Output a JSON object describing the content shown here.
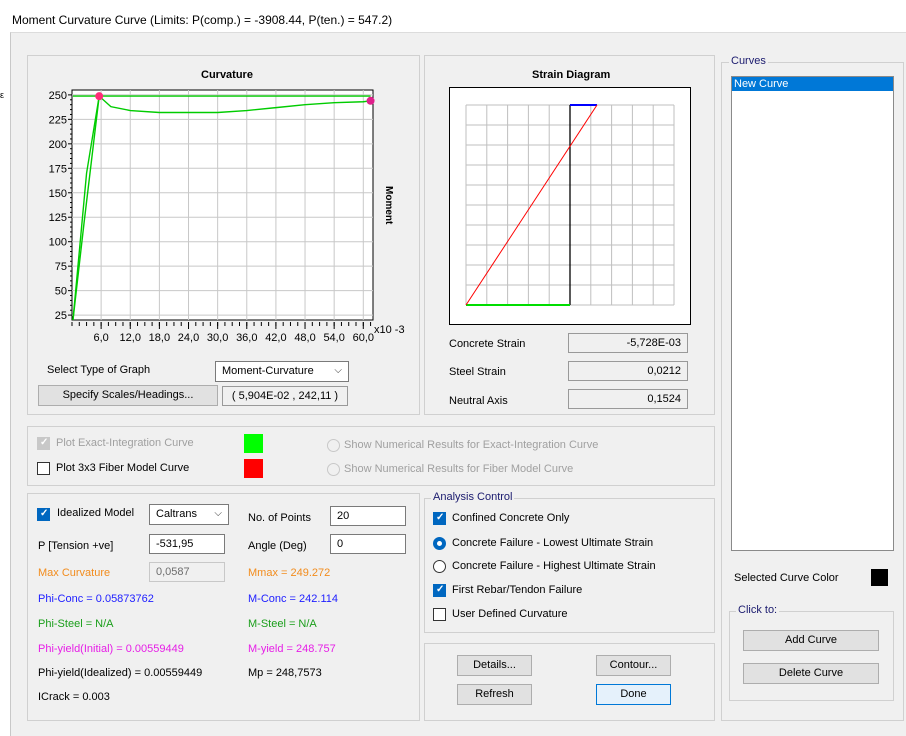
{
  "window": {
    "title": "Moment Curvature Curve (Limits:  P(comp.) = -3908.44, P(ten.) = 547.2)"
  },
  "curvature_plot": {
    "title": "Curvature",
    "ylabel": "Moment",
    "yticks": [
      "250",
      "225",
      "200",
      "175",
      "150",
      "125",
      "100",
      "75",
      "50",
      "25"
    ],
    "xticks": [
      "6,0",
      "12,0",
      "18,0",
      "24,0",
      "30,0",
      "36,0",
      "42,0",
      "48,0",
      "54,0",
      "60,0"
    ],
    "xexp": "x10 -3"
  },
  "chart_data": [
    {
      "type": "line",
      "title": "Curvature",
      "ylabel": "Moment",
      "xunit": "x10 -3",
      "xlim": [
        0,
        62
      ],
      "ylim": [
        20,
        255
      ],
      "series": [
        {
          "color": "#00cc00",
          "x": [
            0.2,
            2.5,
            5.6,
            8,
            12,
            18,
            24,
            30,
            36,
            42,
            48,
            54,
            60,
            61.5
          ],
          "y": [
            20,
            120,
            248.7,
            238,
            234,
            232,
            232,
            232,
            234,
            237,
            240,
            242,
            243,
            244
          ]
        },
        {
          "color": "#00cc00",
          "x": [
            0.2,
            3,
            5.6
          ],
          "y": [
            20,
            170,
            248.7
          ]
        },
        {
          "color": "#00cc00",
          "x": [
            0.2,
            5.6,
            61.5
          ],
          "y": [
            248.757,
            248.757,
            248.757
          ]
        }
      ],
      "markers": [
        {
          "x": 5.6,
          "y": 248.7,
          "color": "#ff2d78"
        },
        {
          "x": 61.5,
          "y": 244,
          "color": "#e0208c"
        }
      ]
    },
    {
      "type": "line",
      "title": "Strain Diagram",
      "series": [
        {
          "color": "#ff0000",
          "values": "diagonal"
        }
      ]
    }
  ],
  "graph_controls": {
    "select_type_label": "Select Type of Graph",
    "graph_type": "Moment-Curvature",
    "specify_button": "Specify Scales/Headings...",
    "coord_readout": "( 5,904E-02 , 242,11 )"
  },
  "strain": {
    "title": "Strain Diagram",
    "concrete_label": "Concrete Strain",
    "concrete_value": "-5,728E-03",
    "steel_label": "Steel Strain",
    "steel_value": "0,0212",
    "neutral_label": "Neutral Axis",
    "neutral_value": "0,1524"
  },
  "curve_options": {
    "exact_label": "Plot Exact-Integration Curve",
    "fiber_label": "Plot 3x3 Fiber Model Curve",
    "exact_color": "#00ff00",
    "fiber_color": "#ff0000",
    "show_exact": "Show Numerical Results for Exact-Integration Curve",
    "show_fiber": "Show Numerical Results for Fiber Model Curve"
  },
  "idealized": {
    "label": "Idealized Model",
    "model": "Caltrans",
    "points_label": "No. of Points",
    "points_value": "20",
    "p_label": "P [Tension +ve]",
    "p_value": "-531,95",
    "angle_label": "Angle (Deg)",
    "angle_value": "0",
    "max_curv_label": "Max Curvature",
    "max_curv_value": "0,0587",
    "mmax": "Mmax = 249.272",
    "phi_conc": "Phi-Conc = 0.05873762",
    "m_conc": "M-Conc = 242.114",
    "phi_steel": "Phi-Steel = N/A",
    "m_steel": "M-Steel = N/A",
    "phi_yield_init": "Phi-yield(Initial) = 0.00559449",
    "m_yield": "M-yield = 248.757",
    "phi_yield_ideal": "Phi-yield(Idealized) = 0.00559449",
    "mp": "Mp = 248,7573",
    "icrack": "ICrack =  0.003"
  },
  "analysis": {
    "title": "Analysis Control",
    "confined": "Confined Concrete Only",
    "lowest": "Concrete Failure - Lowest Ultimate Strain",
    "highest": "Concrete Failure - Highest Ultimate Strain",
    "first_rebar": "First Rebar/Tendon Failure",
    "user_def": "User Defined Curvature"
  },
  "buttons": {
    "details": "Details...",
    "contour": "Contour...",
    "refresh": "Refresh",
    "done": "Done"
  },
  "curves": {
    "title": "Curves",
    "items": [
      "New Curve"
    ],
    "selected_color_label": "Selected Curve Color",
    "selected_color": "#000000",
    "click_to": "Click to:",
    "add": "Add Curve",
    "delete": "Delete Curve"
  }
}
